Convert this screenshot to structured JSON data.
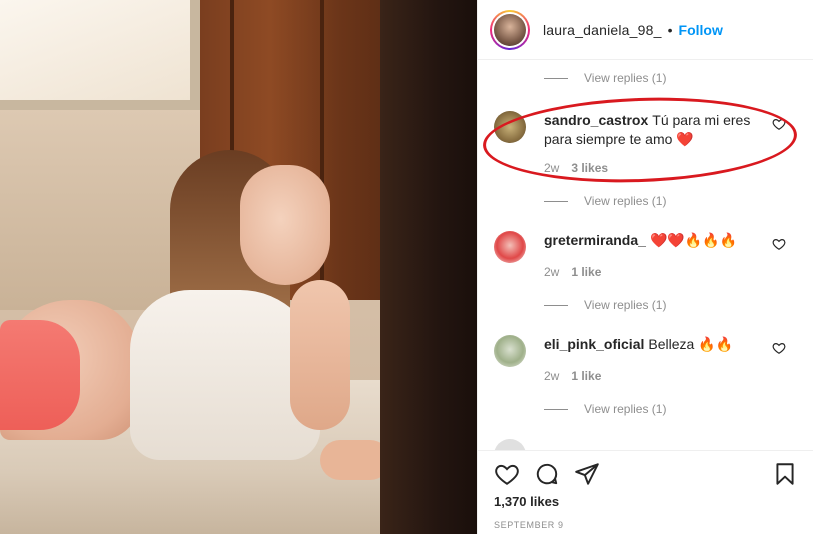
{
  "post": {
    "username": "laura_daniela_98_",
    "separator": "•",
    "follow_label": "Follow",
    "likes": "1,370 likes",
    "date": "SEPTEMBER 9"
  },
  "comments": [
    {
      "username": "sandro_castrox",
      "text": "Tú para mi eres para siempre te amo ❤️",
      "age": "2w",
      "likes": "3 likes",
      "view_replies": "View replies (1)"
    },
    {
      "username": "gretermiranda_",
      "text": "❤️❤️🔥🔥🔥",
      "age": "2w",
      "likes": "1 like",
      "view_replies": "View replies (1)"
    },
    {
      "username": "eli_pink_oficial",
      "text": "Belleza 🔥🔥",
      "age": "2w",
      "likes": "1 like",
      "view_replies": "View replies (1)"
    }
  ],
  "top_view_replies": "View replies (1)",
  "colors": {
    "accent": "#0095f6",
    "annotation": "#d9191f",
    "muted": "#8e8e8e",
    "text": "#262626"
  },
  "icons": {
    "like": "heart-icon",
    "comment": "comment-icon",
    "share": "paper-plane-icon",
    "save": "bookmark-icon"
  }
}
